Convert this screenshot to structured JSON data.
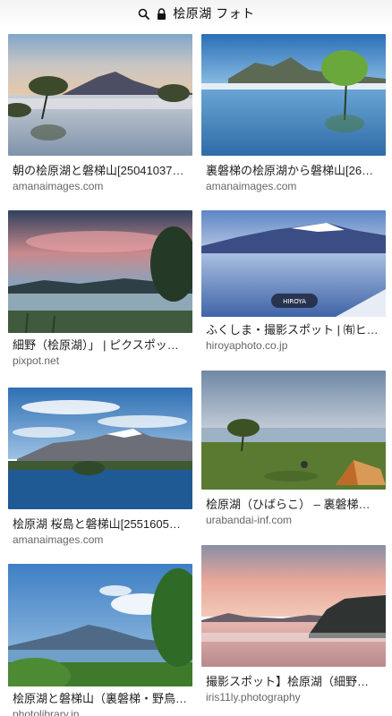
{
  "header": {
    "title": "桧原湖 フォト",
    "search_icon": "search-icon",
    "lock_icon": "lock-icon"
  },
  "results": [
    {
      "title": "朝の桧原湖と磐梯山[25041037…",
      "source": "amanaimages.com"
    },
    {
      "title": "裏磐梯の桧原湖から磐梯山[26…",
      "source": "amanaimages.com"
    },
    {
      "title": "細野（桧原湖）」 | ピクスポッ…",
      "source": "pixpot.net"
    },
    {
      "title": "ふくしま・撮影スポット | ㈲ヒ…",
      "source": "hiroyaphoto.co.jp",
      "watermark": "HIROYA"
    },
    {
      "title": "桧原湖 桜島と磐梯山[2551605…",
      "source": "amanaimages.com"
    },
    {
      "title": "桧原湖（ひばらこ） – 裏磐梯…",
      "source": "urabandai-inf.com"
    },
    {
      "title": "桧原湖と磐梯山（裏磐梯・野鳥…",
      "source": "photolibrary.jp"
    },
    {
      "title": "撮影スポット】桧原湖（細野…",
      "source": "iris11ly.photography"
    }
  ]
}
